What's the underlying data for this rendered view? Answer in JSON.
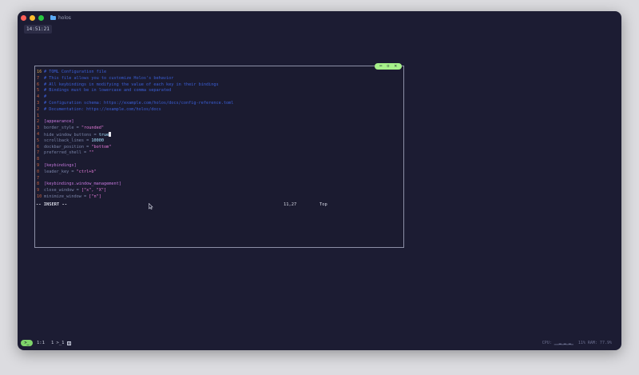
{
  "window": {
    "title": "holos"
  },
  "clock": "14:51:21",
  "pane": {
    "controls": [
      "−",
      "▫",
      "✕"
    ]
  },
  "editor": {
    "lines": [
      {
        "ln": "16",
        "current": true,
        "parts": [
          {
            "t": "# TOML Configuration file",
            "c": "c-comment"
          }
        ]
      },
      {
        "ln": "7",
        "parts": [
          {
            "t": "# This file allows you to customize Holos's behavior",
            "c": "c-comment"
          }
        ]
      },
      {
        "ln": "6",
        "parts": [
          {
            "t": "# All keybindings in modifying the value of each key in their bindings",
            "c": "c-comment"
          }
        ]
      },
      {
        "ln": "5",
        "parts": [
          {
            "t": "# Bindings must be in lowercase and comma separated",
            "c": "c-comment"
          }
        ]
      },
      {
        "ln": "4",
        "parts": [
          {
            "t": "#",
            "c": "c-comment"
          }
        ]
      },
      {
        "ln": "3",
        "parts": [
          {
            "t": "# Configuration schema: https://example.com/holos/docs/config-reference.toml",
            "c": "c-comment"
          }
        ]
      },
      {
        "ln": "2",
        "parts": [
          {
            "t": "# Documentation: https://example.com/holos/docs",
            "c": "c-comment"
          }
        ]
      },
      {
        "ln": "1",
        "parts": [
          {
            "t": "",
            "c": ""
          }
        ]
      },
      {
        "ln": "2",
        "parts": [
          {
            "t": "[appearance]",
            "c": "c-section"
          }
        ]
      },
      {
        "ln": "3",
        "parts": [
          {
            "t": "border_style",
            "c": "c-key"
          },
          {
            "t": " = ",
            "c": "c-op"
          },
          {
            "t": "\"rounded\"",
            "c": "c-str"
          }
        ]
      },
      {
        "ln": "4",
        "cursor": true,
        "parts": [
          {
            "t": "hide_window_buttons",
            "c": "c-key"
          },
          {
            "t": " = ",
            "c": "c-op"
          },
          {
            "t": "true",
            "c": "c-bool"
          }
        ]
      },
      {
        "ln": "5",
        "parts": [
          {
            "t": "scrollback_lines",
            "c": "c-key"
          },
          {
            "t": " = ",
            "c": "c-op"
          },
          {
            "t": "10000",
            "c": "c-num"
          }
        ]
      },
      {
        "ln": "6",
        "parts": [
          {
            "t": "dockbar_position",
            "c": "c-key"
          },
          {
            "t": " = ",
            "c": "c-op"
          },
          {
            "t": "\"bottom\"",
            "c": "c-str"
          }
        ]
      },
      {
        "ln": "7",
        "parts": [
          {
            "t": "preferred_shell",
            "c": "c-key"
          },
          {
            "t": " = ",
            "c": "c-op"
          },
          {
            "t": "\"\"",
            "c": "c-str"
          }
        ]
      },
      {
        "ln": "8",
        "parts": [
          {
            "t": "",
            "c": ""
          }
        ]
      },
      {
        "ln": "9",
        "parts": [
          {
            "t": "[keybindings]",
            "c": "c-section"
          }
        ]
      },
      {
        "ln": "0",
        "parts": [
          {
            "t": "leader_key",
            "c": "c-key"
          },
          {
            "t": " = ",
            "c": "c-op"
          },
          {
            "t": "\"ctrl+b\"",
            "c": "c-str"
          }
        ]
      },
      {
        "ln": "7",
        "parts": [
          {
            "t": "",
            "c": ""
          }
        ]
      },
      {
        "ln": "8",
        "parts": [
          {
            "t": "[keybindings.window_management]",
            "c": "c-section"
          }
        ]
      },
      {
        "ln": "9",
        "parts": [
          {
            "t": "close_window",
            "c": "c-key"
          },
          {
            "t": " = ",
            "c": "c-op"
          },
          {
            "t": "[\"x\", \"X\"]",
            "c": "c-str"
          }
        ]
      },
      {
        "ln": "10",
        "parts": [
          {
            "t": "minimize_window",
            "c": "c-key"
          },
          {
            "t": " = ",
            "c": "c-op"
          },
          {
            "t": "[\"n\"]",
            "c": "c-str"
          }
        ]
      }
    ],
    "status": {
      "mode": "-- INSERT --",
      "position": "11,27",
      "scroll": "Top"
    }
  },
  "bottombar": {
    "mode": ">_",
    "tab_index": "1:1",
    "tab_label": "1 >_1",
    "cpu": "CPU: ▁▁▂▁▂▁▂▁",
    "ram": "11% RAM: 77.9%"
  },
  "colors": {
    "background": "#1c1c33",
    "accent": "#a6f08a",
    "border": "#8c8fa6"
  }
}
